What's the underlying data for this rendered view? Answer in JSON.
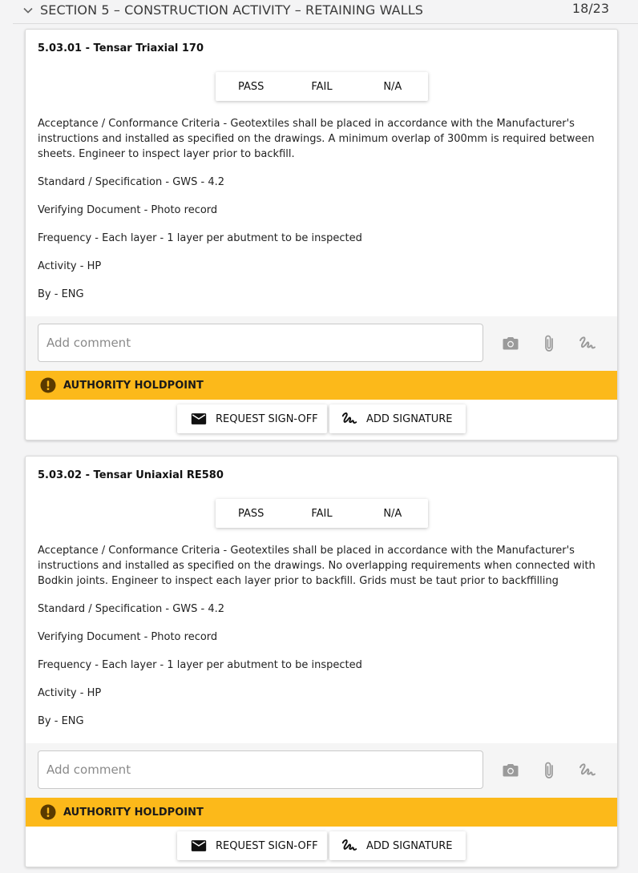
{
  "section": {
    "title": "SECTION 5 – CONSTRUCTION ACTIVITY – RETAINING WALLS",
    "count": "18/23"
  },
  "pass_fail": {
    "pass": "PASS",
    "fail": "FAIL",
    "na": "N/A"
  },
  "comment_placeholder": "Add comment",
  "holdpoint_label": "AUTHORITY HOLDPOINT",
  "actions": {
    "request": "REQUEST SIGN-OFF",
    "signature": "ADD SIGNATURE"
  },
  "items": [
    {
      "title": "5.03.01 - Tensar Triaxial 170",
      "criteria": "Acceptance / Conformance Criteria - Geotextiles shall be placed in accordance with the Manufacturer's instructions and installed as specified on the drawings. A minimum overlap of 300mm is required between sheets. Engineer to inspect layer prior to backfill.",
      "standard": "Standard / Specification - GWS - 4.2",
      "verifying": "Verifying Document - Photo record",
      "frequency": "Frequency - Each layer - 1 layer per abutment to be inspected",
      "activity": "Activity - HP",
      "by": "By - ENG"
    },
    {
      "title": "5.03.02 - Tensar Uniaxial RE580",
      "criteria": "Acceptance / Conformance Criteria - Geotextiles shall be placed in accordance with the Manufacturer's instructions and installed as specified on the drawings. No overlapping requirements when connected with Bodkin joints. Engineer to inspect each layer prior to backfill. Grids must be taut prior to backffilling",
      "standard": "Standard / Specification - GWS - 4.2",
      "verifying": "Verifying Document - Photo record",
      "frequency": "Frequency - Each layer - 1 layer per abutment to be inspected",
      "activity": "Activity - HP",
      "by": "By - ENG"
    }
  ]
}
